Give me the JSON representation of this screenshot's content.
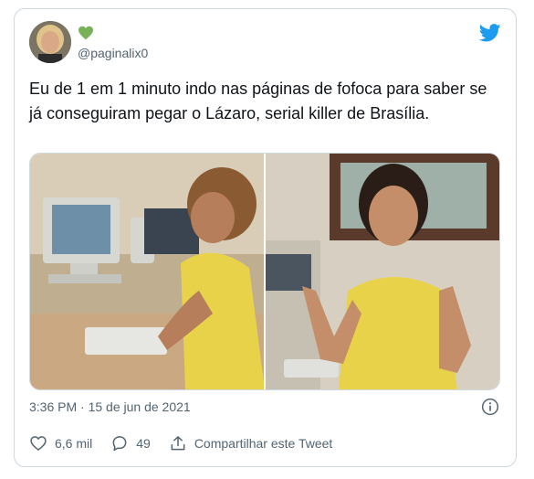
{
  "tweet": {
    "handle": "@paginalix0",
    "text": "Eu de 1 em 1 minuto indo nas páginas de fofoca para saber se já conseguiram pegar o Lázaro, serial killer de Brasília.",
    "timestamp": "3:36 PM · 15 de jun de 2021"
  },
  "actions": {
    "likes": "6,6 mil",
    "replies": "49",
    "share_label": "Compartilhar este Tweet"
  },
  "icons": {
    "heart_badge": "green-heart-icon",
    "brand": "twitter-bird-icon",
    "info": "info-icon",
    "like": "heart-outline-icon",
    "reply": "speech-bubble-icon",
    "share": "share-upload-icon"
  },
  "colors": {
    "brand_blue": "#1d9bf0",
    "heart_green": "#78b159",
    "muted_text": "#536471",
    "border": "#cfd9de"
  }
}
